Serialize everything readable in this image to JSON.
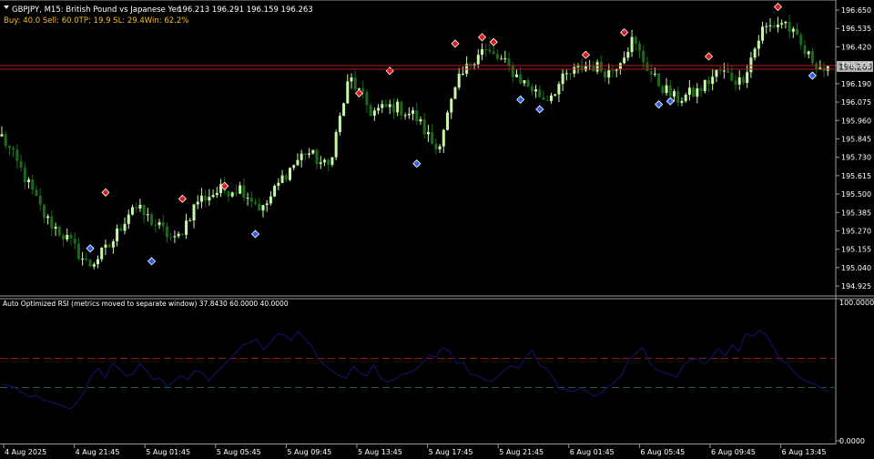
{
  "header": {
    "symbol_line": "GBPJPY, M15:  British Pound vs Japanese Yen",
    "ohlc": "196.213 196.291 196.159 196.263",
    "stats": "Buy: 40.0  Sell: 60.0TP: 19.9  SL: 29.4Win: 62.2%"
  },
  "current_price": "196.263",
  "rsi_panel": {
    "title": "Auto Optimized RSI (metrics moved to separate window) 37.8430 60.0000 40.0000",
    "scale_top": "100.0000",
    "scale_bottom": "0.0000"
  },
  "colors": {
    "background": "#000000",
    "bull_candle": "#c8f7a8",
    "bear_candle": "#1a6b1a",
    "sell_arrow": "#e01818",
    "buy_arrow": "#2f5fe0",
    "price_line": "#b02020",
    "rsi_line": "#10105a",
    "rsi_upper_level": "#8a1a1a",
    "rsi_lower_level": "#1a5a3a",
    "axis_text": "#ffffff",
    "price_tag": "#b0b0b0"
  },
  "chart_data": [
    {
      "type": "candlestick",
      "title": "GBPJPY, M15",
      "y_ticks": [
        "196.650",
        "196.535",
        "196.420",
        "196.305",
        "196.190",
        "196.075",
        "195.960",
        "195.845",
        "195.730",
        "195.615",
        "195.500",
        "195.385",
        "195.270",
        "195.155",
        "195.040",
        "194.925"
      ],
      "ylim": [
        194.88,
        196.69
      ],
      "x_ticks": [
        "4 Aug 2025",
        "4 Aug 21:45",
        "5 Aug 01:45",
        "5 Aug 05:45",
        "5 Aug 09:45",
        "5 Aug 13:45",
        "5 Aug 17:45",
        "5 Aug 21:45",
        "6 Aug 01:45",
        "6 Aug 05:45",
        "6 Aug 09:45",
        "6 Aug 13:45"
      ],
      "close_path": [
        195.86,
        195.62,
        195.35,
        195.22,
        195.05,
        195.18,
        195.43,
        195.32,
        195.2,
        195.46,
        195.52,
        195.54,
        195.4,
        195.62,
        195.77,
        195.66,
        196.23,
        196.01,
        196.05,
        195.99,
        195.78,
        196.2,
        196.41,
        196.33,
        196.2,
        196.09,
        196.24,
        196.31,
        196.26,
        196.46,
        196.22,
        196.09,
        196.14,
        196.27,
        196.2,
        196.53,
        196.58,
        196.37,
        196.26
      ],
      "sell_signals": [
        {
          "i": 27,
          "price": 195.51
        },
        {
          "i": 47,
          "price": 195.47
        },
        {
          "i": 58,
          "price": 195.55
        },
        {
          "i": 93,
          "price": 196.13
        },
        {
          "i": 101,
          "price": 196.27
        },
        {
          "i": 118,
          "price": 196.44
        },
        {
          "i": 125,
          "price": 196.48
        },
        {
          "i": 128,
          "price": 196.45
        },
        {
          "i": 152,
          "price": 196.37
        },
        {
          "i": 162,
          "price": 196.51
        },
        {
          "i": 184,
          "price": 196.36
        },
        {
          "i": 202,
          "price": 196.67
        }
      ],
      "buy_signals": [
        {
          "i": 23,
          "price": 195.16
        },
        {
          "i": 39,
          "price": 195.08
        },
        {
          "i": 66,
          "price": 195.25
        },
        {
          "i": 108,
          "price": 195.69
        },
        {
          "i": 135,
          "price": 196.09
        },
        {
          "i": 140,
          "price": 196.03
        },
        {
          "i": 171,
          "price": 196.06
        },
        {
          "i": 174,
          "price": 196.08
        },
        {
          "i": 211,
          "price": 196.24
        }
      ],
      "current_price": 196.263
    },
    {
      "type": "line",
      "title": "Auto Optimized RSI (metrics moved to separate window)",
      "ylim": [
        0,
        100
      ],
      "levels": [
        60.0,
        40.0
      ],
      "last_value": 37.843,
      "rsi_path": [
        40,
        39,
        37,
        33,
        30,
        31,
        27,
        26,
        24,
        22,
        20,
        26,
        34,
        47,
        53,
        45,
        57,
        53,
        47,
        48,
        57,
        51,
        44,
        45,
        38,
        43,
        47,
        44,
        51,
        50,
        43,
        49,
        54,
        60,
        66,
        72,
        74,
        77,
        68,
        74,
        81,
        80,
        76,
        83,
        77,
        71,
        60,
        55,
        51,
        47,
        45,
        55,
        49,
        47,
        56,
        45,
        42,
        44,
        48,
        49,
        52,
        57,
        64,
        62,
        70,
        67,
        57,
        58,
        48,
        47,
        44,
        42,
        46,
        52,
        55,
        53,
        62,
        68,
        56,
        53,
        46,
        36,
        36,
        34,
        37,
        34,
        30,
        33,
        38,
        42,
        48,
        60,
        65,
        70,
        58,
        52,
        50,
        48,
        46,
        56,
        60,
        61,
        56,
        62,
        69,
        63,
        72,
        67,
        81,
        79,
        84,
        80,
        70,
        60,
        57,
        50,
        45,
        42,
        40,
        37,
        34
      ]
    }
  ]
}
